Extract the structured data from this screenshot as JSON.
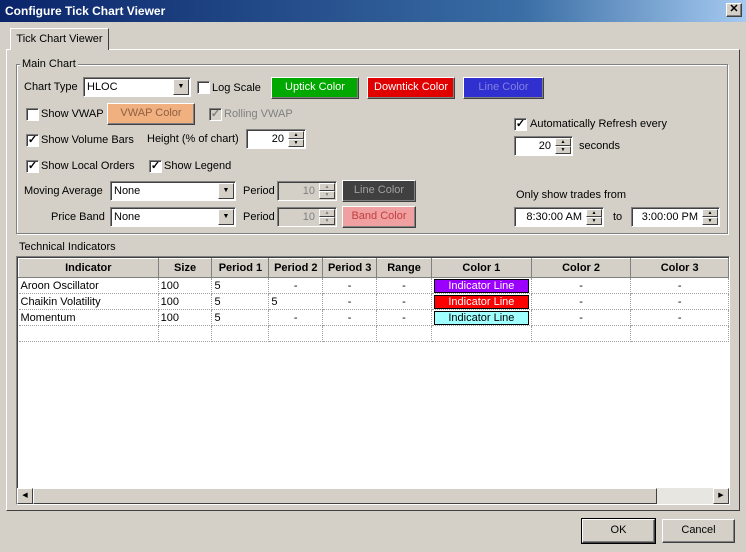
{
  "window": {
    "title": "Configure Tick Chart Viewer",
    "close": "✕"
  },
  "tab": {
    "label": "Tick Chart Viewer"
  },
  "main_chart": {
    "group_label": "Main Chart",
    "chart_type_label": "Chart Type",
    "chart_type_value": "HLOC",
    "log_scale_label": "Log Scale",
    "log_scale_checked": false,
    "uptick_color_label": "Uptick Color",
    "uptick_color": "#00a800",
    "downtick_color_label": "Downtick Color",
    "downtick_color": "#e00000",
    "line_color_label": "Line Color",
    "line_color": "#3030d0",
    "show_vwap_label": "Show VWAP",
    "vwap_color_label": "VWAP Color",
    "vwap_color": "#f0b080",
    "rolling_vwap_label": "Rolling VWAP",
    "show_volume_bars_label": "Show Volume Bars",
    "height_label": "Height (% of chart)",
    "height_value": "20",
    "show_local_orders_label": "Show Local Orders",
    "show_legend_label": "Show Legend",
    "moving_average_label": "Moving Average",
    "moving_average_value": "None",
    "ma_period_label": "Period",
    "ma_period_value": "10",
    "ma_line_color_label": "Line Color",
    "ma_line_color": "#404040",
    "price_band_label": "Price Band",
    "price_band_value": "None",
    "pb_period_label": "Period",
    "pb_period_value": "10",
    "band_color_label": "Band Color",
    "band_color": "#f0a0a0",
    "auto_refresh_label": "Automatically Refresh every",
    "refresh_value": "20",
    "seconds_label": "seconds",
    "only_show_label": "Only show trades from",
    "from_time": "8:30:00 AM",
    "to_label": "to",
    "to_time": "3:00:00 PM"
  },
  "technical_indicators": {
    "label": "Technical Indicators",
    "columns": [
      "Indicator",
      "Size",
      "Period 1",
      "Period 2",
      "Period 3",
      "Range",
      "Color 1",
      "Color 2",
      "Color 3"
    ],
    "rows": [
      {
        "indicator": "Aroon Oscillator",
        "size": "100",
        "p1": "5",
        "p2": "-",
        "p3": "-",
        "range": "-",
        "color1_label": "Indicator Line",
        "color1": "#9b00ff",
        "color1_text": "#ffffff",
        "color2": "-",
        "color3": "-"
      },
      {
        "indicator": "Chaikin Volatility",
        "size": "100",
        "p1": "5",
        "p2": "5",
        "p3": "-",
        "range": "-",
        "color1_label": "Indicator Line",
        "color1": "#ff0000",
        "color1_text": "#ffffff",
        "color2": "-",
        "color3": "-"
      },
      {
        "indicator": "Momentum",
        "size": "100",
        "p1": "5",
        "p2": "-",
        "p3": "-",
        "range": "-",
        "color1_label": "Indicator Line",
        "color1": "#a0ffff",
        "color1_text": "#000000",
        "color2": "-",
        "color3": "-"
      }
    ]
  },
  "buttons": {
    "ok": "OK",
    "cancel": "Cancel"
  }
}
